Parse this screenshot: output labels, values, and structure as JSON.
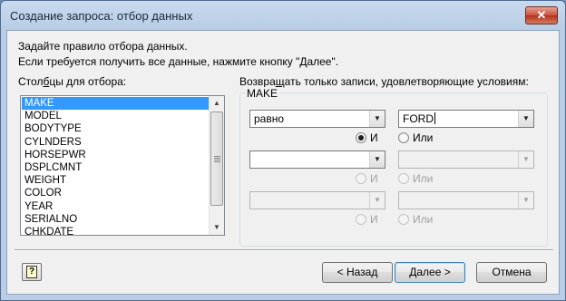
{
  "window": {
    "title": "Создание запроса: отбор данных",
    "close_label": "✕"
  },
  "intro": {
    "line1": "Задайте правило отбора данных.",
    "line2": "Если требуется получить все данные, нажмите кнопку \"Далее\"."
  },
  "columns": {
    "label_pre": "Стол",
    "label_accel": "б",
    "label_post": "цы для отбора:",
    "items": [
      "MAKE",
      "MODEL",
      "BODYTYPE",
      "CYLNDERS",
      "HORSEPWR",
      "DSPLCMNT",
      "WEIGHT",
      "COLOR",
      "YEAR",
      "SERIALNO",
      "CHKDATE"
    ],
    "selected_index": 0
  },
  "criteria": {
    "label_pre": "Возвра",
    "label_accel": "щ",
    "label_post": "ать только записи, удовлетворяющие условиям:",
    "group_title": "MAKE",
    "row1": {
      "operator": "равно",
      "value": "FORD"
    },
    "and_label": "И",
    "or_label": "Или"
  },
  "buttons": {
    "help": "?",
    "back": "< Назад",
    "next": "Далее >",
    "cancel": "Отмена"
  },
  "colors": {
    "selection": "#3399ff",
    "title_bar": "#c8daee"
  }
}
